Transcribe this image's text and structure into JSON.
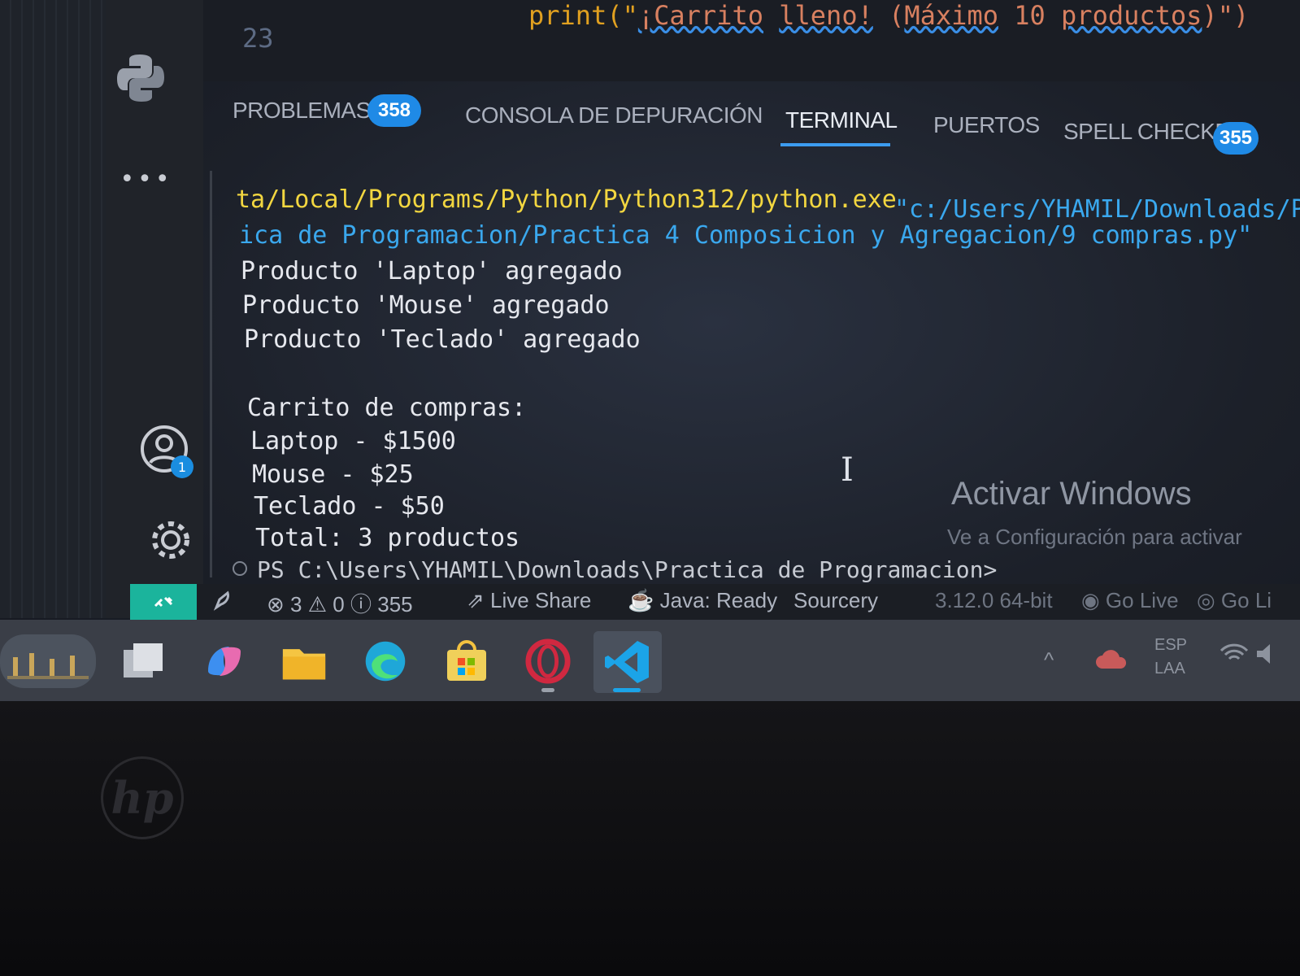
{
  "editor": {
    "line_number": "23",
    "code_prefix": "print(\"",
    "code_string_parts": [
      "¡Carrito",
      " ",
      "lleno!",
      " (",
      "Máximo",
      " 10 ",
      "productos",
      ")\")"
    ]
  },
  "panel": {
    "tabs": [
      {
        "label": "PROBLEMAS",
        "badge": "358"
      },
      {
        "label": "CONSOLA DE DEPURACIÓN"
      },
      {
        "label": "TERMINAL"
      },
      {
        "label": "PUERTOS"
      },
      {
        "label": "SPELL CHECKER",
        "badge": "355"
      }
    ]
  },
  "terminal": {
    "cmd_exe": "ta/Local/Programs/Python/Python312/python.exe",
    "cmd_arg_1": "\"c:/Users/YHAMIL/Downloads/Pr",
    "cmd_arg_2": "ica de Programacion/Practica 4 Composicion y Agregacion/9 compras.py\"",
    "lines": [
      "Producto 'Laptop' agregado",
      "Producto 'Mouse' agregado",
      "Producto 'Teclado' agregado",
      "",
      "Carrito de compras:",
      "Laptop - $1500",
      "Mouse - $25",
      "Teclado - $50",
      "Total: 3 productos"
    ],
    "prompt": "PS C:\\Users\\YHAMIL\\Downloads\\Practica de Programacion>"
  },
  "watermark": {
    "title": "Activar Windows",
    "subtitle": "Ve a Configuración para activar"
  },
  "activity": {
    "account_badge": "1"
  },
  "status_bar": {
    "errors": "3",
    "warnings": "0",
    "info": "355",
    "live_share": "Live Share",
    "java": "Java: Ready",
    "sourcery": "Sourcery",
    "python_version": "3.12.0 64-bit",
    "go_live": "Go Live",
    "go_live_2": "Go Li"
  },
  "tray": {
    "lang_1": "ESP",
    "lang_2": "LAA"
  },
  "bezel": {
    "brand": "hp"
  },
  "colors": {
    "accent": "#1f8ae6",
    "remote": "#1bb49c",
    "terminal_yellow": "#f2d640",
    "terminal_blue": "#3aa8ee"
  }
}
